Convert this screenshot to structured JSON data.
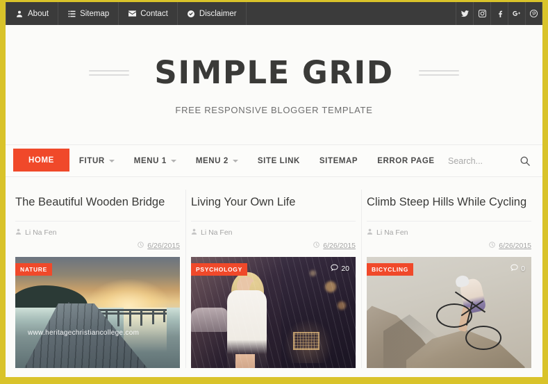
{
  "theme": {
    "page_border_color": "#d9c32a",
    "accent_color": "#f0492a",
    "topbar_color": "#3b3b3b",
    "background_color": "#fbfbf9"
  },
  "topbar": {
    "links": [
      {
        "label": "About",
        "icon": "user-icon"
      },
      {
        "label": "Sitemap",
        "icon": "list-icon"
      },
      {
        "label": "Contact",
        "icon": "envelope-icon"
      },
      {
        "label": "Disclaimer",
        "icon": "check-circle-icon"
      }
    ],
    "socials": [
      {
        "name": "twitter-icon"
      },
      {
        "name": "instagram-icon"
      },
      {
        "name": "facebook-icon"
      },
      {
        "name": "googleplus-icon"
      },
      {
        "name": "pinterest-icon"
      }
    ]
  },
  "header": {
    "site_title": "SIMPLE GRID",
    "tagline": "FREE RESPONSIVE BLOGGER TEMPLATE"
  },
  "mainnav": {
    "items": [
      {
        "label": "HOME",
        "active": true,
        "dropdown": false
      },
      {
        "label": "FITUR",
        "active": false,
        "dropdown": true
      },
      {
        "label": "MENU 1",
        "active": false,
        "dropdown": true
      },
      {
        "label": "MENU 2",
        "active": false,
        "dropdown": true
      },
      {
        "label": "SITE LINK",
        "active": false,
        "dropdown": false
      },
      {
        "label": "SITEMAP",
        "active": false,
        "dropdown": false
      },
      {
        "label": "ERROR PAGE",
        "active": false,
        "dropdown": false
      }
    ],
    "search": {
      "placeholder": "Search...",
      "value": "",
      "icon": "search-icon"
    }
  },
  "posts": [
    {
      "title": "The Beautiful Wooden Bridge",
      "author": "Li Na Fen",
      "date": "6/26/2015",
      "category": "NATURE",
      "comments": "",
      "watermark": "www.heritagechristiancollege.com",
      "image_alt": "wooden pier over calm water at sunset"
    },
    {
      "title": "Living Your Own Life",
      "author": "Li Na Fen",
      "date": "6/26/2015",
      "category": "PSYCHOLOGY",
      "comments": "20",
      "watermark": "",
      "image_alt": "blonde woman in white tank top on a city street"
    },
    {
      "title": "Climb Steep Hills While Cycling",
      "author": "Li Na Fen",
      "date": "6/26/2015",
      "category": "BICYCLING",
      "comments": "0",
      "watermark": "",
      "image_alt": "cyclist riding up a steep rocky hill"
    }
  ]
}
